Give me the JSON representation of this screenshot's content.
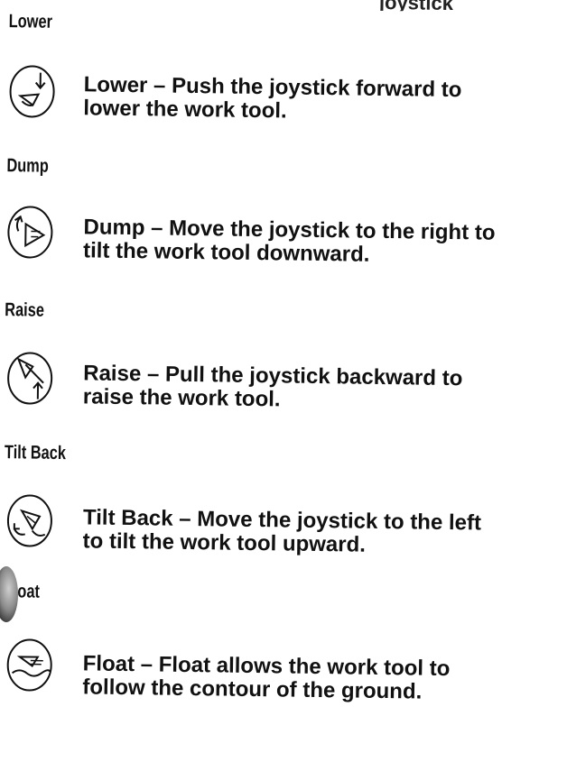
{
  "sections": [
    {
      "heading": "Lower",
      "icon": "lower-icon",
      "line1": "Lower – Push the joystick forward to",
      "line2": "lower the work tool."
    },
    {
      "heading": "Dump",
      "icon": "dump-icon",
      "line1": "Dump – Move the joystick to the right to",
      "line2": "tilt the work tool downward."
    },
    {
      "heading": "Raise",
      "icon": "raise-icon",
      "line1": "Raise – Pull the joystick backward to",
      "line2": "raise the work tool."
    },
    {
      "heading": "Tilt Back",
      "icon": "tilt-back-icon",
      "line1": "Tilt Back – Move the joystick to the left",
      "line2": "to tilt the work tool upward."
    },
    {
      "heading": "Float",
      "icon": "float-icon",
      "line1": "Float – Float allows the work tool to",
      "line2": "follow the contour of the ground."
    }
  ],
  "colors": {
    "ink": "#111111",
    "paper": "#ffffff"
  }
}
